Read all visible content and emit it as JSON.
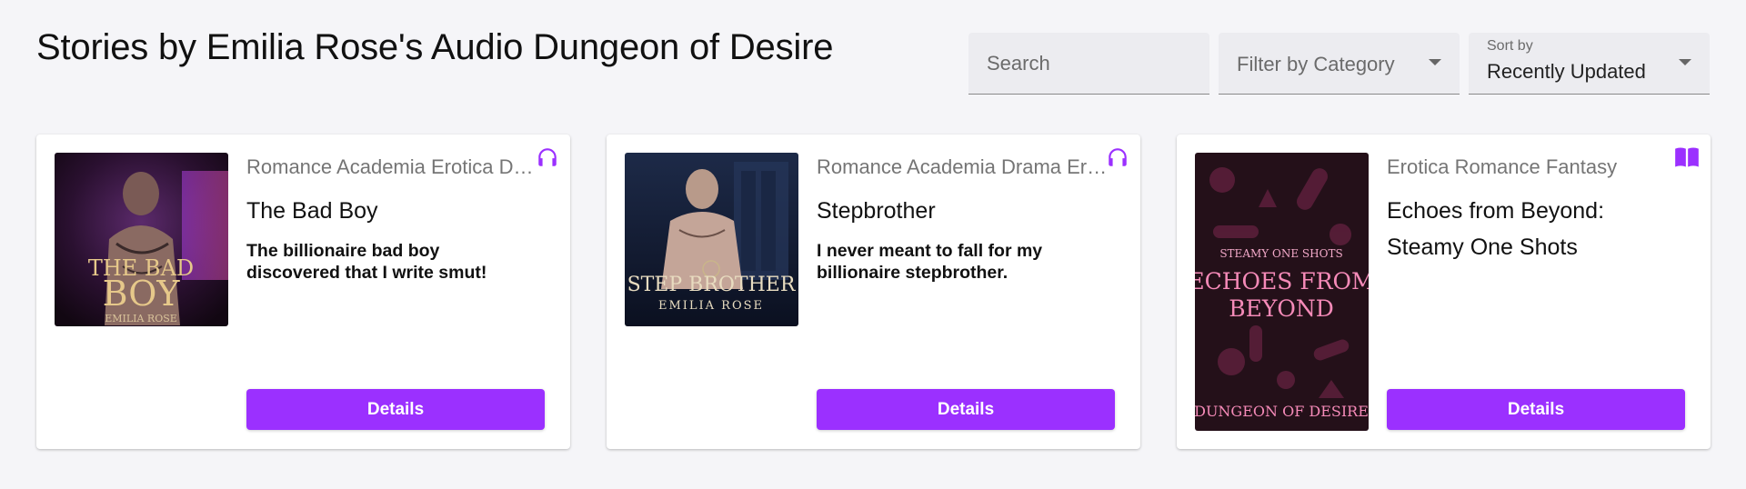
{
  "page": {
    "title": "Stories by Emilia Rose's Audio Dungeon of Desire"
  },
  "search": {
    "placeholder": "Search"
  },
  "filter": {
    "placeholder": "Filter by Category"
  },
  "sort": {
    "label": "Sort by",
    "value": "Recently Updated"
  },
  "colors": {
    "accent": "#9b30ff",
    "background": "#f5f5f8"
  },
  "stories": [
    {
      "categories": "Romance Academia Erotica Drama",
      "title": "The Bad Boy",
      "tagline": "The billionaire bad boy discovered that I write smut!",
      "type_icon": "headphones-icon",
      "button": "Details",
      "cover": {
        "line1": "THE BAD",
        "line2": "BOY",
        "author": "EMILIA ROSE"
      }
    },
    {
      "categories": "Romance Academia Drama Erotica",
      "title": "Stepbrother",
      "tagline": "I never meant to fall for my billionaire stepbrother.",
      "type_icon": "headphones-icon",
      "button": "Details",
      "cover": {
        "line1": "STEP BROTHER",
        "author": "EMILIA ROSE"
      }
    },
    {
      "categories": "Erotica Romance Fantasy",
      "title": "Echoes from Beyond: Steamy One Shots",
      "tagline": "",
      "type_icon": "book-icon",
      "button": "Details",
      "cover": {
        "kicker": "STEAMY ONE SHOTS",
        "line1": "ECHOES FROM",
        "line2": "BEYOND",
        "footer": "DUNGEON OF DESIRE"
      }
    }
  ]
}
